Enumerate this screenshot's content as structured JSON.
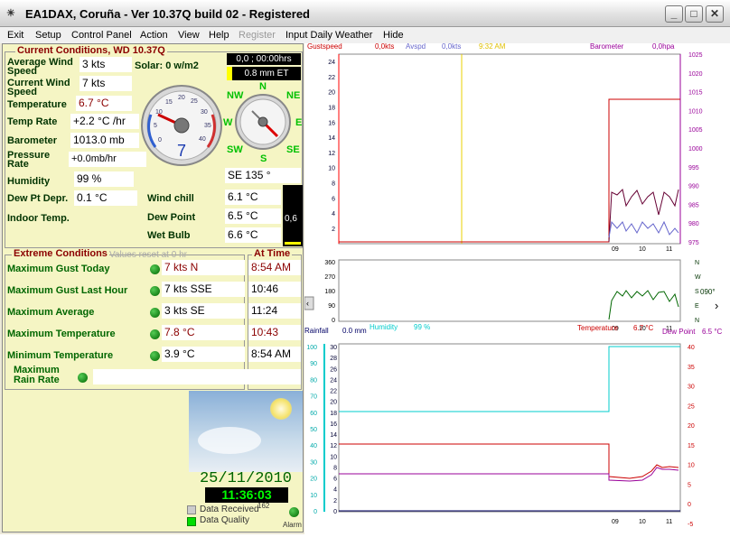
{
  "window": {
    "icon": "☀",
    "title": "EA1DAX, Coruña - Ver 10.37Q build 02 - Registered",
    "min": "_",
    "max": "□",
    "close": "✕"
  },
  "menu": [
    "Exit",
    "Setup",
    "Control Panel",
    "Action",
    "View",
    "Help",
    "Register",
    "Input Daily Weather",
    "Hide"
  ],
  "current": {
    "heading": "Current Conditions, WD 10.37Q",
    "avg_wind_label": "Average Wind Speed",
    "avg_wind": "3 kts",
    "solar": "Solar: 0 w/m2",
    "rain_today": "0,0 ; 00:00hrs",
    "et": "0.8 mm ET",
    "cur_wind_label": "Current Wind Speed",
    "cur_wind": "7 kts",
    "temp_label": "Temperature",
    "temp": "6.7 °C",
    "temp_rate_label": "Temp Rate",
    "temp_rate": "+2.2 °C /hr",
    "baro_label": "Barometer",
    "baro": "1013.0 mb",
    "prate_label": "Pressure Rate",
    "prate": "+0.0mb/hr",
    "hum_label": "Humidity",
    "hum": "99 %",
    "dewdep_label": "Dew Pt Depr.",
    "dewdep": "0.1 °C",
    "indoor_label": "Indoor Temp.",
    "chill_label": "Wind chill",
    "chill": "6.1 °C",
    "dew_label": "Dew Point",
    "dew": "6.5 °C",
    "bulb_label": "Wet Bulb",
    "bulb": "6.6 °C",
    "winddir": "SE  135 °",
    "bar_value": "0,6",
    "gauge_speed": "7",
    "compass": {
      "N": "N",
      "NE": "NE",
      "E": "E",
      "SE": "SE",
      "S": "S",
      "SW": "SW",
      "W": "W",
      "NW": "NW"
    }
  },
  "extremes": {
    "heading": "Extreme Conditions",
    "reset_note": "Values reset at 0 hr",
    "time_heading": "At Time",
    "rows": [
      {
        "label": "Maximum Gust Today",
        "value": "7 kts N",
        "time": "8:54 AM",
        "red": true
      },
      {
        "label": "Maximum Gust Last Hour",
        "value": "7 kts SSE",
        "time": "10:46",
        "red": false
      },
      {
        "label": "Maximum Average",
        "value": "3 kts SE",
        "time": "11:24",
        "red": false
      },
      {
        "label": "Maximum Temperature",
        "value": "7.8 °C",
        "time": "10:43",
        "red": true
      },
      {
        "label": "Minimum Temperature",
        "value": "3.9 °C",
        "time": "8:54 AM",
        "red": false
      }
    ],
    "rain_label": "Maximum Rain Rate"
  },
  "bottom": {
    "date": "25/11/2010",
    "time": "11:36:03",
    "data_received": "Data Received",
    "count": "162",
    "data_quality": "Data Quality",
    "alarm": "Alarm"
  },
  "graphs": {
    "g1": {
      "left": "Gustspeed",
      "left_val": "0,0kts",
      "avg": "Avspd",
      "avg_val": "0,0kts",
      "time": "9:32 AM",
      "right": "Barometer",
      "right_val": "0,0hpa",
      "yl": [
        "24",
        "22",
        "20",
        "18",
        "16",
        "14",
        "12",
        "10",
        "8",
        "6",
        "4",
        "2"
      ],
      "yr": [
        "1025",
        "1020",
        "1015",
        "1010",
        "1005",
        "1000",
        "995",
        "990",
        "985",
        "980",
        "975"
      ],
      "x": [
        "09",
        "10",
        "11"
      ]
    },
    "g2": {
      "yl": [
        "360",
        "270",
        "180",
        "90",
        "0"
      ],
      "dirs": [
        "N",
        "W",
        "S",
        "E",
        "N"
      ],
      "val": "090°",
      "x": [
        "09",
        "10",
        "11"
      ]
    },
    "g3": {
      "rain": "Rainfall",
      "rain_val": "0.0 mm",
      "hum": "Humidity",
      "hum_val": "99 %",
      "temp": "Temperature",
      "temp_val": "6.7 °C",
      "dew": "Dew Point",
      "dew_val": "6.5 °C",
      "ylh": [
        "100",
        "90",
        "80",
        "70",
        "60",
        "50",
        "40",
        "30",
        "20",
        "10",
        "0"
      ],
      "ylt": [
        "30",
        "28",
        "26",
        "24",
        "22",
        "20",
        "18",
        "16",
        "14",
        "12",
        "10",
        "8",
        "6",
        "4",
        "2",
        "0"
      ],
      "yr": [
        "40",
        "35",
        "30",
        "25",
        "20",
        "15",
        "10",
        "5",
        "0",
        "-5"
      ],
      "x": [
        "09",
        "10",
        "11"
      ]
    }
  },
  "colors": {
    "panel": "#f5f5c4",
    "heading": "#8b0000",
    "label": "#003300",
    "extreme": "#006600",
    "gust": "#ff0000",
    "baro": "#990099",
    "avg": "#3333cc",
    "humid": "#00cccc",
    "temp": "#cc0000",
    "dew": "#990099"
  }
}
